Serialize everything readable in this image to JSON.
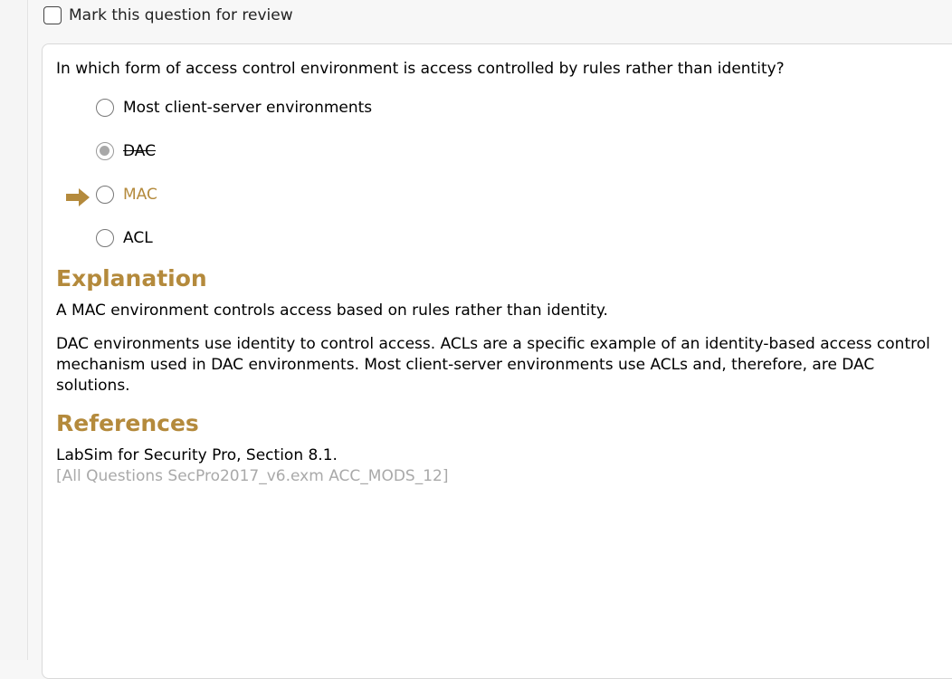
{
  "review": {
    "label": "Mark this question for review",
    "checked": false
  },
  "question": {
    "text": "In which form of access control environment is access controlled by rules rather than identity?",
    "options": [
      {
        "label": "Most client-server environments",
        "selected": false,
        "struck": false,
        "correct": false
      },
      {
        "label": "DAC",
        "selected": true,
        "struck": true,
        "correct": false
      },
      {
        "label": "MAC",
        "selected": false,
        "struck": false,
        "correct": true
      },
      {
        "label": "ACL",
        "selected": false,
        "struck": false,
        "correct": false
      }
    ]
  },
  "explanation": {
    "heading": "Explanation",
    "paragraphs": [
      "A MAC environment controls access based on rules rather than identity.",
      "DAC environments use identity to control access. ACLs are a specific example of an identity-based access control mechanism used in DAC environments. Most client-server environments use ACLs and, therefore, are DAC solutions."
    ]
  },
  "references": {
    "heading": "References",
    "source": "LabSim for Security Pro, Section 8.1.",
    "question_id": "[All Questions SecPro2017_v6.exm ACC_MODS_12]"
  },
  "colors": {
    "accent": "#b48a3c",
    "muted": "#a9a9a9"
  },
  "icons": {
    "correct_indicator": "arrow-right-icon"
  }
}
